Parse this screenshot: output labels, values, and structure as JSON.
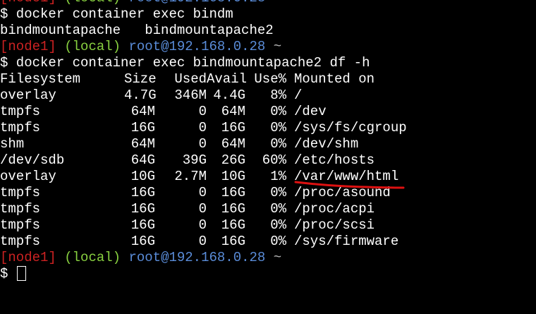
{
  "terminal": {
    "top_partial": {
      "node": "[node1]",
      "local": "(local)",
      "userhost": "root@192.168.0.28",
      "tilde": "~"
    },
    "cmd1": "$ docker container exec bindm",
    "completions": "bindmountapache   bindmountapache2",
    "prompt1": {
      "node": "[node1]",
      "local": "(local)",
      "userhost": "root@192.168.0.28",
      "tilde": "~"
    },
    "cmd2": "$ docker container exec bindmountapache2 df -h",
    "df_header": {
      "filesystem": "Filesystem",
      "size": "Size",
      "used": "Used",
      "avail": "Avail",
      "use": "Use%",
      "mounted": "Mounted on"
    },
    "df_rows": [
      {
        "filesystem": "overlay",
        "size": "4.7G",
        "used": "346M",
        "avail": "4.4G",
        "use": "8%",
        "mounted": "/"
      },
      {
        "filesystem": "tmpfs",
        "size": "64M",
        "used": "0",
        "avail": "64M",
        "use": "0%",
        "mounted": "/dev"
      },
      {
        "filesystem": "tmpfs",
        "size": "16G",
        "used": "0",
        "avail": "16G",
        "use": "0%",
        "mounted": "/sys/fs/cgroup"
      },
      {
        "filesystem": "shm",
        "size": "64M",
        "used": "0",
        "avail": "64M",
        "use": "0%",
        "mounted": "/dev/shm"
      },
      {
        "filesystem": "/dev/sdb",
        "size": "64G",
        "used": "39G",
        "avail": "26G",
        "use": "60%",
        "mounted": "/etc/hosts"
      },
      {
        "filesystem": "overlay",
        "size": "10G",
        "used": "2.7M",
        "avail": "10G",
        "use": "1%",
        "mounted": "/var/www/html"
      },
      {
        "filesystem": "tmpfs",
        "size": "16G",
        "used": "0",
        "avail": "16G",
        "use": "0%",
        "mounted": "/proc/asound"
      },
      {
        "filesystem": "tmpfs",
        "size": "16G",
        "used": "0",
        "avail": "16G",
        "use": "0%",
        "mounted": "/proc/acpi"
      },
      {
        "filesystem": "tmpfs",
        "size": "16G",
        "used": "0",
        "avail": "16G",
        "use": "0%",
        "mounted": "/proc/scsi"
      },
      {
        "filesystem": "tmpfs",
        "size": "16G",
        "used": "0",
        "avail": "16G",
        "use": "0%",
        "mounted": "/sys/firmware"
      }
    ],
    "prompt2": {
      "node": "[node1]",
      "local": "(local)",
      "userhost": "root@192.168.0.28",
      "tilde": "~"
    },
    "final_prompt": "$"
  },
  "colors": {
    "background": "#000000",
    "node": "#cc2222",
    "local": "#88d040",
    "userhost": "#5a8cd8",
    "annotation": "#dd1111"
  },
  "icons": {
    "cursor": "block-cursor-icon",
    "annotation": "red-underline-annotation"
  }
}
